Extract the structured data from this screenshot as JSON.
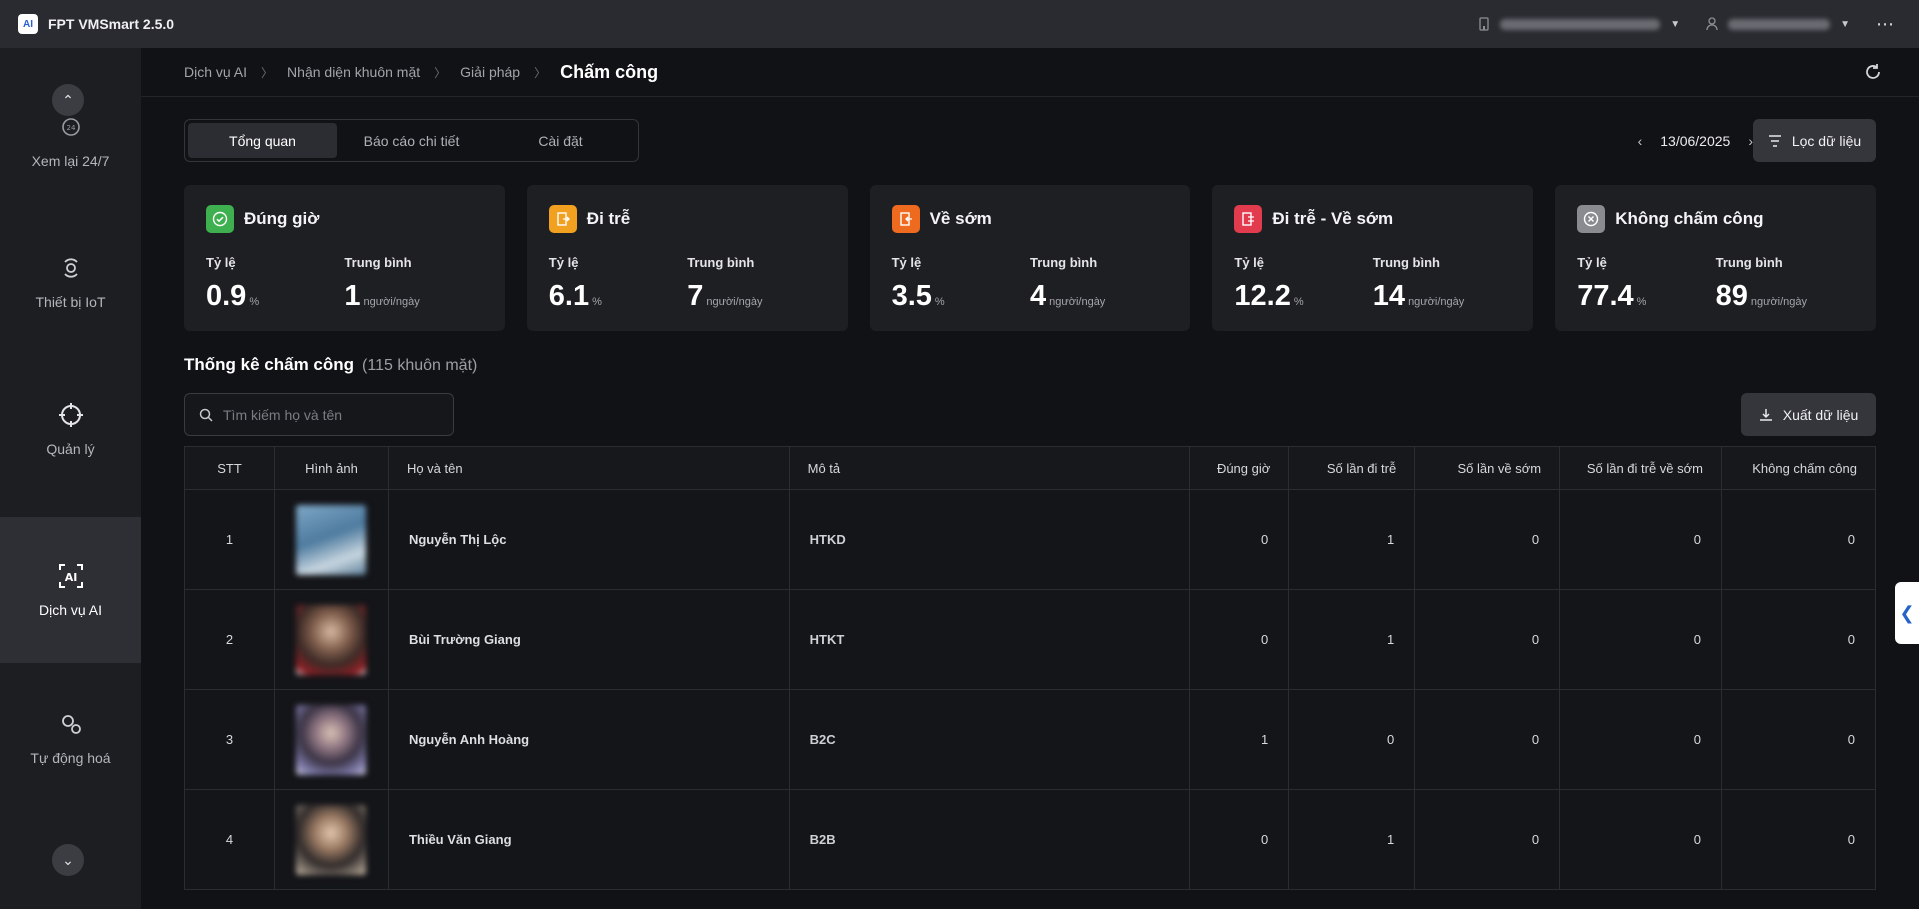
{
  "app": {
    "title": "FPT VMSmart 2.5.0",
    "logo_text": "AI"
  },
  "topbar": {
    "location_name": "■■■■■ ■■■ ■■■■■■ ■■■",
    "user_name": "■■■■ ■■■ ■■■"
  },
  "sidebar": {
    "items": [
      {
        "label": "Xem lại 24/7"
      },
      {
        "label": "Thiết bị IoT"
      },
      {
        "label": "Quản lý"
      },
      {
        "label": "Dịch vụ AI"
      },
      {
        "label": "Tự động hoá"
      }
    ],
    "active": "Dịch vụ AI"
  },
  "breadcrumb": {
    "items": [
      "Dịch vụ AI",
      "Nhận diện khuôn mặt",
      "Giải pháp"
    ],
    "current": "Chấm công"
  },
  "tabs": [
    {
      "label": "Tổng quan"
    },
    {
      "label": "Báo cáo chi tiết"
    },
    {
      "label": "Cài đặt"
    }
  ],
  "date": "13/06/2025",
  "filter_label": "Lọc dữ liệu",
  "cards": [
    {
      "title": "Đúng giờ",
      "rate_label": "Tỷ lệ",
      "rate": "0.9",
      "rate_unit": "%",
      "avg_label": "Trung bình",
      "avg": "1",
      "avg_unit": "người/ngày",
      "color": "#3fb04f"
    },
    {
      "title": "Đi trễ",
      "rate_label": "Tỷ lệ",
      "rate": "6.1",
      "rate_unit": "%",
      "avg_label": "Trung bình",
      "avg": "7",
      "avg_unit": "người/ngày",
      "color": "#f2a01f"
    },
    {
      "title": "Về sớm",
      "rate_label": "Tỷ lệ",
      "rate": "3.5",
      "rate_unit": "%",
      "avg_label": "Trung bình",
      "avg": "4",
      "avg_unit": "người/ngày",
      "color": "#ee6a1f"
    },
    {
      "title": "Đi trễ - Về sớm",
      "rate_label": "Tỷ lệ",
      "rate": "12.2",
      "rate_unit": "%",
      "avg_label": "Trung bình",
      "avg": "14",
      "avg_unit": "người/ngày",
      "color": "#e23b4e"
    },
    {
      "title": "Không chấm công",
      "rate_label": "Tỷ lệ",
      "rate": "77.4",
      "rate_unit": "%",
      "avg_label": "Trung bình",
      "avg": "89",
      "avg_unit": "người/ngày",
      "color": "#8a8b91"
    }
  ],
  "section": {
    "title": "Thống kê chấm công",
    "count": "(115 khuôn mặt)"
  },
  "search": {
    "placeholder": "Tìm kiếm họ và tên"
  },
  "export_label": "Xuất dữ liệu",
  "table": {
    "columns": [
      "STT",
      "Hình ảnh",
      "Họ và tên",
      "Mô tả",
      "Đúng giờ",
      "Số lần đi trễ",
      "Số lần về sớm",
      "Số lần đi trễ về sớm",
      "Không chấm công"
    ],
    "rows": [
      {
        "stt": "1",
        "name": "Nguyễn Thị Lộc",
        "desc": "HTKD",
        "ontime": "0",
        "late": "1",
        "early": "0",
        "late_early": "0",
        "absent": "0"
      },
      {
        "stt": "2",
        "name": "Bùi Trường Giang",
        "desc": "HTKT",
        "ontime": "0",
        "late": "1",
        "early": "0",
        "late_early": "0",
        "absent": "0"
      },
      {
        "stt": "3",
        "name": "Nguyễn Anh Hoàng",
        "desc": "B2C",
        "ontime": "1",
        "late": "0",
        "early": "0",
        "late_early": "0",
        "absent": "0"
      },
      {
        "stt": "4",
        "name": "Thiều Văn Giang",
        "desc": "B2B",
        "ontime": "0",
        "late": "1",
        "early": "0",
        "late_early": "0",
        "absent": "0"
      }
    ]
  }
}
